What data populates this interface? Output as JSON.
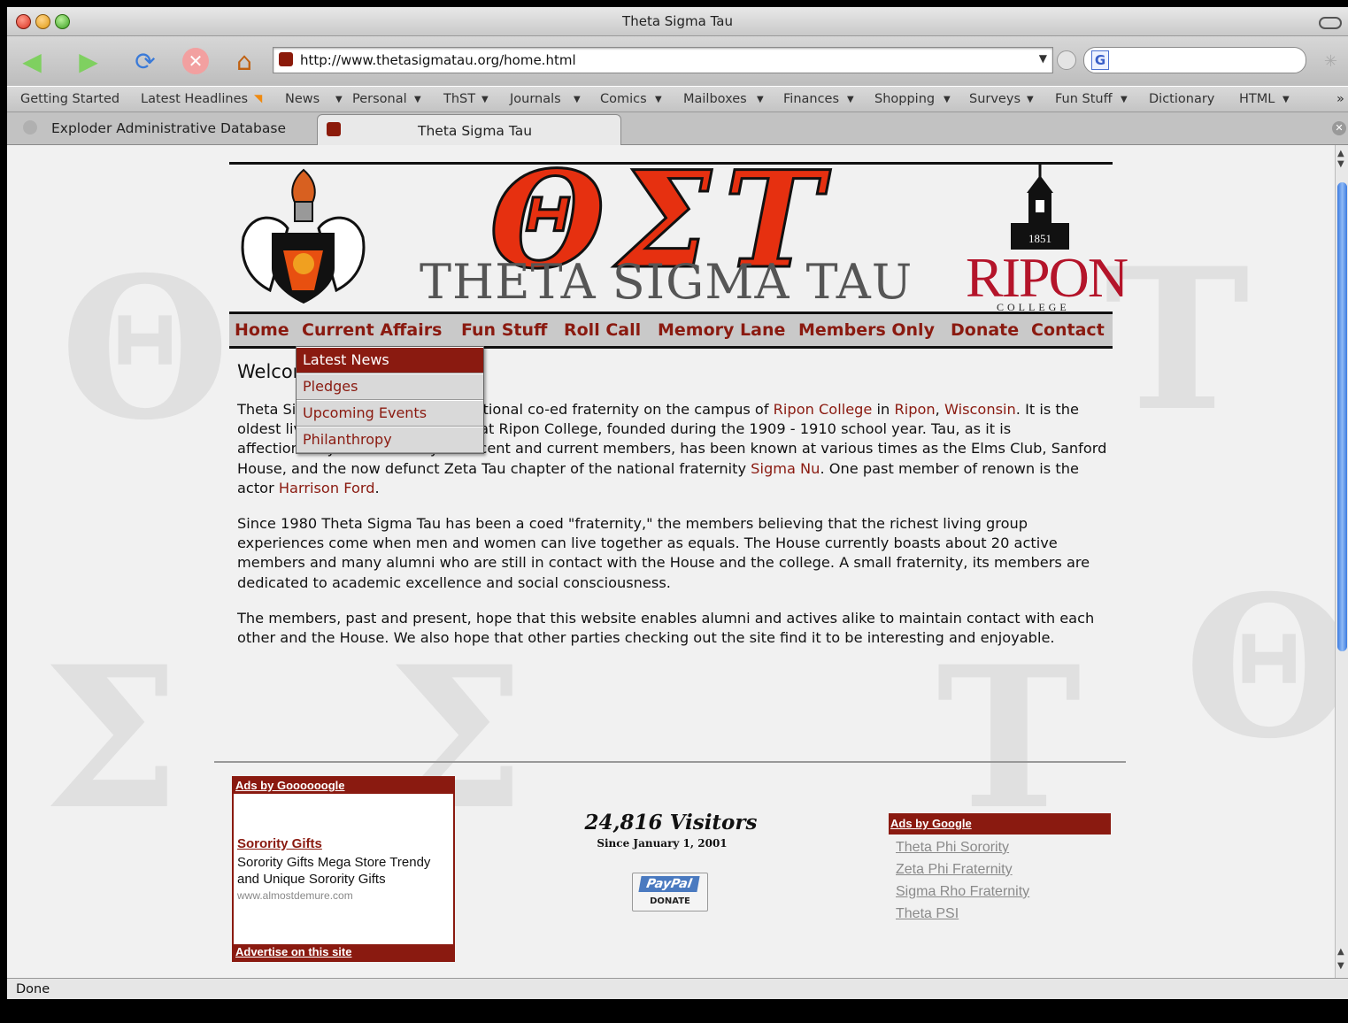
{
  "window": {
    "title": "Theta Sigma Tau"
  },
  "toolbar": {
    "url": "http://www.thetasigmatau.org/home.html"
  },
  "bookmarks": [
    "Getting Started",
    "Latest Headlines",
    "News",
    "Personal",
    "ThST",
    "Journals",
    "Comics",
    "Mailboxes",
    "Finances",
    "Shopping",
    "Surveys",
    "Fun Stuff",
    "Dictionary",
    "HTML"
  ],
  "tabs": [
    {
      "label": "Exploder Administrative Database"
    },
    {
      "label": "Theta Sigma Tau"
    }
  ],
  "header": {
    "greek": "ΘΣΤ",
    "brand": "THETA SIGMA TAU",
    "ripon": "RIPON",
    "college": "COLLEGE",
    "bell_year": "1851"
  },
  "menu": [
    "Home",
    "Current Affairs",
    "Fun Stuff",
    "Roll Call",
    "Memory Lane",
    "Members Only",
    "Donate",
    "Contact"
  ],
  "dropdown": [
    "Latest News",
    "Pledges",
    "Upcoming Events",
    "Philanthropy"
  ],
  "main": {
    "welcome": "Welcome",
    "p1_a": "Theta Sigma Tau is a local, non-national co-ed fraternity on the campus of ",
    "p1_link1": "Ripon College",
    "p1_b": " in ",
    "p1_link2": "Ripon",
    "p1_c": ", ",
    "p1_link3": "Wisconsin",
    "p1_d": ". It is the oldest living group in the country at Ripon College, founded during the 1909 - 1910 school year. Tau, as it is affectionately referred to by its recent and current members, has been known at various times as the Elms Club, Sanford House, and the now defunct Zeta Tau chapter of the national fraternity ",
    "p1_link4": "Sigma Nu",
    "p1_e": ". One past member of renown is the actor ",
    "p1_link5": "Harrison Ford",
    "p1_f": ".",
    "p2": "Since 1980 Theta Sigma Tau has been a coed \"fraternity,\" the members believing that the richest living group experiences come when men and women can live together as equals. The House currently boasts about 20 active members and many alumni who are still in contact with the House and the college. A small fraternity, its members are dedicated to academic excellence and social consciousness.",
    "p3": "The members, past and present, hope that this website enables alumni and actives alike to maintain contact with each other and the House. We also hope that other parties checking out the site find it to be interesting and enjoyable."
  },
  "ad_left": {
    "header": "Ads by Goooooogle",
    "title": "Sorority Gifts",
    "desc": "Sorority Gifts Mega Store Trendy and Unique Sorority Gifts",
    "url": "www.almostdemure.com",
    "footer": "Advertise on this site"
  },
  "visitors": {
    "count": "24,816 Visitors",
    "since": "Since January 1, 2001"
  },
  "paypal": {
    "logo": "PayPal",
    "label": "DONATE"
  },
  "ad_right": {
    "header": "Ads by Google",
    "links": [
      "Theta Phi Sorority",
      "Zeta Phi Fraternity",
      "Sigma Rho Fraternity",
      "Theta PSI"
    ]
  },
  "status": "Done",
  "colors": {
    "accent": "#8a1a10",
    "greek": "#e63010",
    "ripon": "#b4142a"
  }
}
